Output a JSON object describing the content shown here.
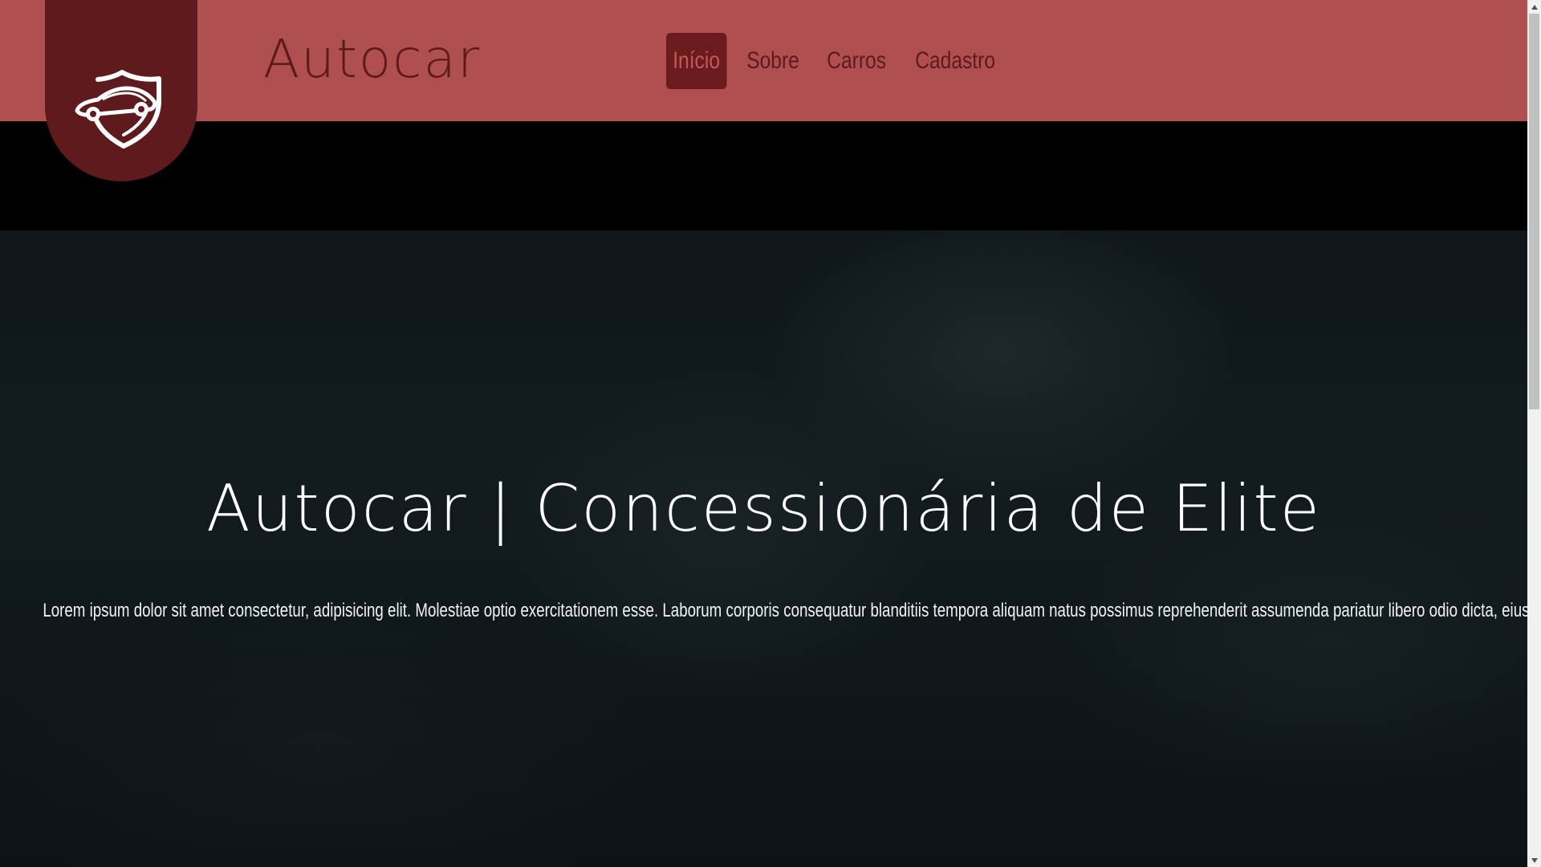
{
  "header": {
    "brand": "Autocar",
    "logo_icon": "car-shield-logo",
    "nav": [
      {
        "label": "Início",
        "active": true
      },
      {
        "label": "Sobre",
        "active": false
      },
      {
        "label": "Carros",
        "active": false
      },
      {
        "label": "Cadastro",
        "active": false
      }
    ]
  },
  "hero": {
    "title": "Autocar | Concessionária de Elite",
    "text": "Lorem ipsum dolor sit amet consectetur, adipisicing elit. Molestiae optio exercitationem esse. Laborum corporis consequatur blanditiis tempora aliquam natus possimus reprehenderit assumenda pariatur libero odio dicta, eius inventore sit iste."
  },
  "colors": {
    "header_bg": "#b04f4f",
    "logo_bg": "#5e1a1c",
    "nav_active_bg": "#6b1a1d",
    "brand_text": "#5b1b1d"
  }
}
